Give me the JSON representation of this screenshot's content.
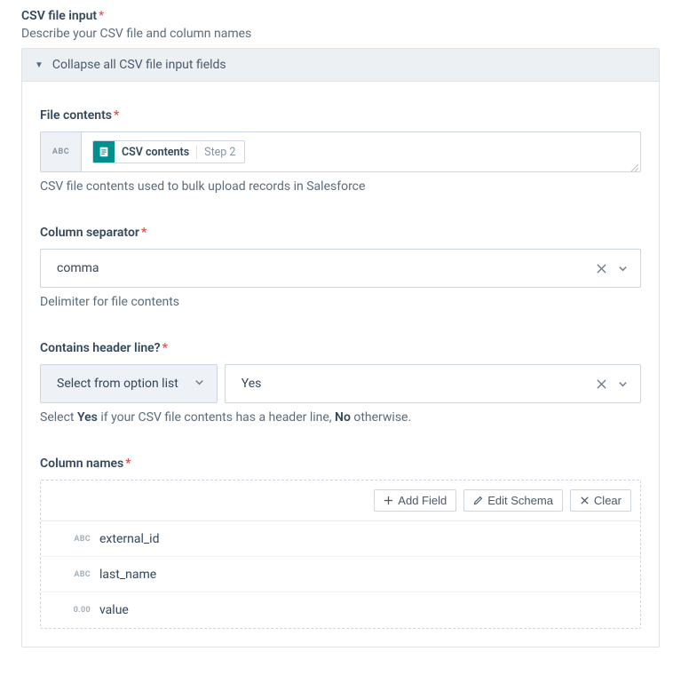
{
  "section": {
    "title": "CSV file input",
    "desc": "Describe your CSV file and column names"
  },
  "collapse": {
    "label": "Collapse all CSV file input fields"
  },
  "file_contents": {
    "label": "File contents",
    "badge": "ABC",
    "pill_main": "CSV contents",
    "pill_step": "Step 2",
    "help": "CSV file contents used to bulk upload records in Salesforce"
  },
  "separator": {
    "label": "Column separator",
    "value": "comma",
    "help": "Delimiter for file contents"
  },
  "header_line": {
    "label": "Contains header line?",
    "option_mode": "Select from option list",
    "value": "Yes",
    "help_pre": "Select ",
    "help_yes": "Yes",
    "help_mid": " if your CSV file contents has a header line, ",
    "help_no": "No",
    "help_post": " otherwise."
  },
  "column_names": {
    "label": "Column names",
    "add": "Add Field",
    "edit": "Edit Schema",
    "clear": "Clear",
    "rows": [
      {
        "type": "ABC",
        "name": "external_id"
      },
      {
        "type": "ABC",
        "name": "last_name"
      },
      {
        "type": "0.00",
        "name": "value"
      }
    ]
  }
}
